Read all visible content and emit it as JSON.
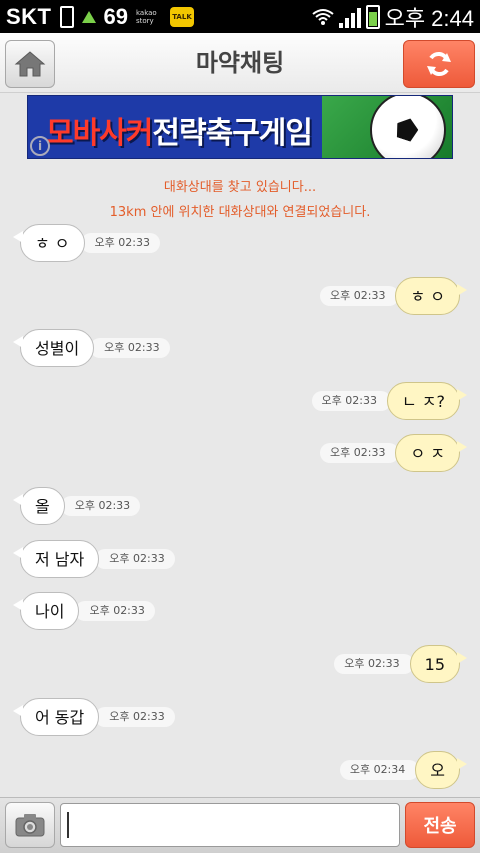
{
  "status_bar": {
    "carrier": "SKT",
    "app_number": "69",
    "story_label": "kakao story",
    "talk_label": "TALK",
    "time": "오후 2:44"
  },
  "header": {
    "title": "마약채팅",
    "home_icon": "home-icon",
    "refresh_icon": "refresh-icon"
  },
  "banner": {
    "text_part1": "모바사커",
    "text_part2": "전략축구게임",
    "info_icon": "i"
  },
  "system_messages": [
    "대화상대를 찾고 있습니다...",
    "13km 안에 위치한 대화상대와 연결되었습니다."
  ],
  "messages": [
    {
      "side": "in",
      "text": "ㅎ ㅇ",
      "time": "오후 02:33"
    },
    {
      "side": "out",
      "text": "ㅎ ㅇ",
      "time": "오후 02:33"
    },
    {
      "side": "in",
      "text": "성별이",
      "time": "오후 02:33"
    },
    {
      "side": "out",
      "text": "ㄴ ㅈ?",
      "time": "오후 02:33"
    },
    {
      "side": "out",
      "text": "ㅇ ㅈ",
      "time": "오후 02:33"
    },
    {
      "side": "in",
      "text": "올",
      "time": "오후 02:33"
    },
    {
      "side": "in",
      "text": "저 남자",
      "time": "오후 02:33"
    },
    {
      "side": "in",
      "text": "나이",
      "time": "오후 02:33"
    },
    {
      "side": "out",
      "text": "15",
      "time": "오후 02:33"
    },
    {
      "side": "in",
      "text": "어 동갑",
      "time": "오후 02:33"
    },
    {
      "side": "out",
      "text": "오",
      "time": "오후 02:34"
    }
  ],
  "input": {
    "value": "",
    "placeholder": "",
    "send_label": "전송",
    "camera_icon": "camera-icon"
  },
  "colors": {
    "accent": "#f06040",
    "system_text": "#e35d2a",
    "bubble_out": "#fff6c4",
    "bubble_in": "#ffffff",
    "background": "#e8e8e8"
  }
}
